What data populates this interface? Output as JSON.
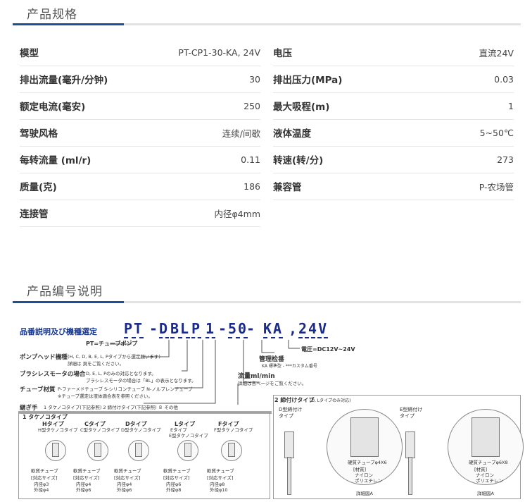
{
  "spec": {
    "title": "产品规格",
    "left": [
      {
        "label": "模型",
        "value": "PT-CP1-30-KA, 24V"
      },
      {
        "label": "排出流量(毫升/分钟)",
        "value": "30"
      },
      {
        "label": "额定电流(毫安)",
        "value": "250"
      },
      {
        "label": "驾驶风格",
        "value": "连续/间歇"
      },
      {
        "label": "每转流量 (ml/r)",
        "value": "0.11"
      },
      {
        "label": "质量(克)",
        "value": "186"
      },
      {
        "label": "连接管",
        "value": "内径φ4mm"
      }
    ],
    "right": [
      {
        "label": "电压",
        "value": "直流24V"
      },
      {
        "label": "排出压力(MPa)",
        "value": "0.03"
      },
      {
        "label": "最大吸程(m)",
        "value": "1"
      },
      {
        "label": "液体温度",
        "value": "5~50℃"
      },
      {
        "label": "转速(转/分)",
        "value": "273"
      },
      {
        "label": "兼容管",
        "value": "P-农场管"
      }
    ]
  },
  "numbering": {
    "title": "产品编号说明",
    "heading": "品番説明及び機種選定",
    "code": [
      "PT",
      "-",
      "D",
      "BL",
      "P",
      "1",
      "-",
      "50",
      "-",
      "KA",
      ",",
      "24V"
    ],
    "pt_label": "PT=チューブポンプ",
    "voltage": "電圧=DC12V~24V",
    "mgmt_label": "管理检番",
    "mgmt_sub": "KA 標準型  -     ***カスタム番号",
    "pump_head_label": "ポンプヘッド機種",
    "pump_head_sub": "(H, C, D, B, E, L, Pタイプから選定願います)",
    "pump_head_sub2": "詳細は 頁をご覧ください。",
    "flow_label": "流量ml/min",
    "flow_sub": "詳細は各ページをご覧ください。",
    "brushless_label": "ブラシレスモータの場合",
    "brushless_sub": "D, E, L, Pのみの対応となります。",
    "brushless_sub2": "ブラシレスモータの場合は「BL」の表示となります。",
    "tube_label": "チューブ材質",
    "tube_sub": "P-ファーメドチューブ  S-シリコンチューブ  N-ノルプレンチューブ",
    "tube_sub2": "※チューブ選定は液体適合表を参照ください。",
    "joint_label": "継ぎ手",
    "joint_sub": "1 タケノコタイプ(下記参照)   2 締付けタイプ(下記参照)   ８ その他",
    "type1_title": "1 タケノコタイプ",
    "type2_title": "2 締付けタイプ",
    "type2_sub": "(D, Lタイプのみ対応)",
    "types": [
      {
        "name": "Hタイプ",
        "sub": "H型タケノコタイプ",
        "tube": "軟質チューブ",
        "size": "[対応サイズ]",
        "inner": "内径φ3",
        "outer": "外径φ4"
      },
      {
        "name": "Cタイプ",
        "sub": "C型タケノコタイプ",
        "tube": "軟質チューブ",
        "size": "[対応サイズ]",
        "inner": "内径φ4",
        "outer": "外径φ6"
      },
      {
        "name": "Dタイプ",
        "sub": "D型タケノコタイプ",
        "tube": "軟質チューブ",
        "size": "[対応サイズ]",
        "inner": "内径φ4",
        "outer": "外径φ6"
      },
      {
        "name": "Lタイプ",
        "sub": "Eタイプ",
        "sub2": "E型タケノコタイプ",
        "tube": "軟質チューブ",
        "size": "[対応サイズ]",
        "inner": "内径φ6",
        "outer": "外径φ8"
      },
      {
        "name": "Fタイプ",
        "sub": "F型タケノコタイプ",
        "tube": "軟質チューブ",
        "size": "[対応サイズ]",
        "inner": "内径φ8",
        "outer": "外径φ10"
      }
    ],
    "clamp": [
      {
        "name": "D型締付け",
        "name2": "タイプ",
        "hard": "硬質チューブφ4X6",
        "material": "[材質]",
        "m1": "ナイロン",
        "m2": "ポリエチレン",
        "detail": "詳細図A"
      },
      {
        "name": "E型締付け",
        "name2": "タイプ",
        "hard": "硬質チューブφ6X8",
        "material": "[材質]",
        "m1": "ナイロン",
        "m2": "ポリエチレン",
        "detail": "詳細図A"
      }
    ]
  },
  "colors": {
    "accent": "#1b4f96",
    "code": "#1a2a8a"
  }
}
